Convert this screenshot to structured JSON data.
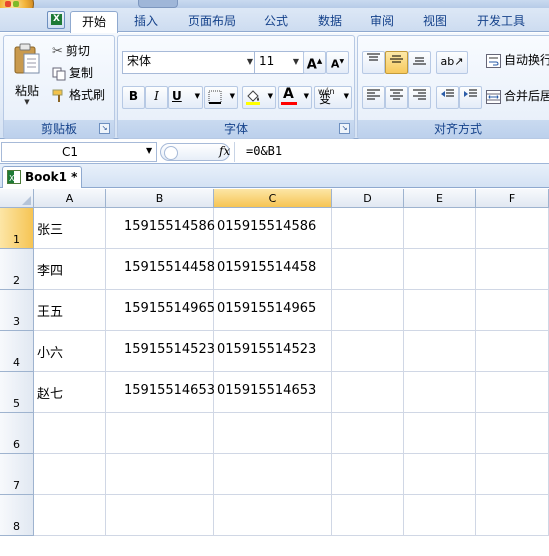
{
  "tabs": [
    "开始",
    "插入",
    "页面布局",
    "公式",
    "数据",
    "审阅",
    "视图",
    "开发工具"
  ],
  "clipboard": {
    "paste_label": "粘贴",
    "cut_label": "剪切",
    "copy_label": "复制",
    "format_painter_label": "格式刷",
    "group_label": "剪贴板"
  },
  "font": {
    "font_name": "宋体",
    "font_size": "11",
    "grow_label": "A",
    "shrink_label": "A",
    "bold_label": "B",
    "italic_label": "I",
    "underline_label": "U",
    "font_color_label": "A",
    "phonetic_label": "wén",
    "phonetic_char": "变",
    "group_label": "字体"
  },
  "alignment": {
    "wrap_label": "自动换行",
    "merge_label": "合并后居",
    "group_label": "对齐方式"
  },
  "formula_bar": {
    "name_box": "C1",
    "fx_label": "fx",
    "formula": "=0&B1"
  },
  "workbook": {
    "tab_label": "Book1 *"
  },
  "columns": [
    "A",
    "B",
    "C",
    "D",
    "E",
    "F"
  ],
  "rows": [
    {
      "num": "1",
      "a": "张三",
      "b": "15915514586",
      "c": "015915514586"
    },
    {
      "num": "2",
      "a": "李四",
      "b": "15915514458",
      "c": "015915514458"
    },
    {
      "num": "3",
      "a": "王五",
      "b": "15915514965",
      "c": "015915514965"
    },
    {
      "num": "4",
      "a": "小六",
      "b": "15915514523",
      "c": "015915514523"
    },
    {
      "num": "5",
      "a": "赵七",
      "b": "15915514653",
      "c": "015915514653"
    },
    {
      "num": "6",
      "a": "",
      "b": "",
      "c": ""
    },
    {
      "num": "7",
      "a": "",
      "b": "",
      "c": ""
    },
    {
      "num": "8",
      "a": "",
      "b": "",
      "c": ""
    }
  ],
  "colors": {
    "ribbon_text": "#15428b",
    "font_color_bar": "#ff0000",
    "highlight_bar": "#ffff00"
  }
}
